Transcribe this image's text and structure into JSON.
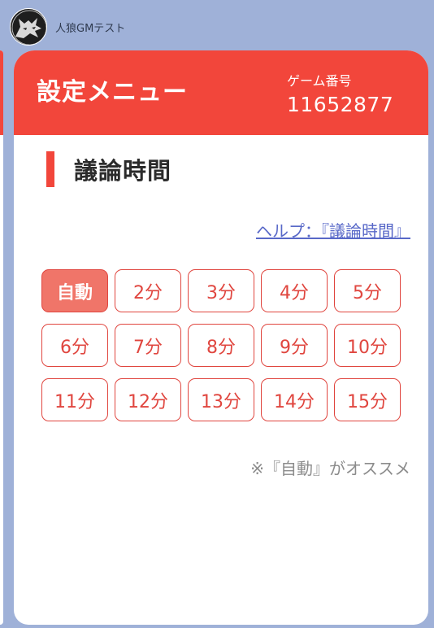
{
  "chat": {
    "sender_name": "人狼GMテスト"
  },
  "card": {
    "title": "設定メニュー",
    "game_number_label": "ゲーム番号",
    "game_number_value": "11652877",
    "section_title": "議論時間",
    "help_link": "ヘルプ：『議論時間』",
    "note": "※『自動』がオススメ",
    "options": [
      "自動",
      "2分",
      "3分",
      "4分",
      "5分",
      "6分",
      "7分",
      "8分",
      "9分",
      "10分",
      "11分",
      "12分",
      "13分",
      "14分",
      "15分"
    ],
    "selected_option": "自動"
  },
  "colors": {
    "accent_red": "#f2463b",
    "selected_fill": "#f07569",
    "link_blue": "#5868c8",
    "chat_background": "#9fb1d8"
  },
  "icons": {
    "avatar": "wolf-avatar-icon"
  }
}
